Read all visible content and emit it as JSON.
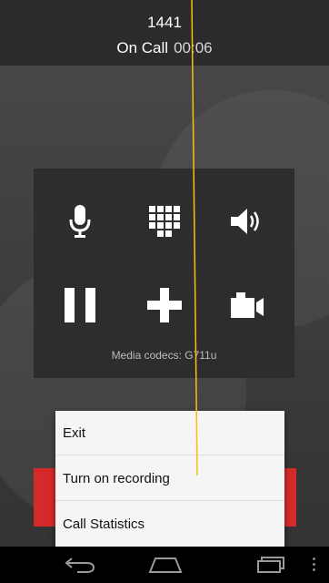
{
  "call": {
    "number": "1441",
    "status": "On Call",
    "timer": "00:06"
  },
  "controls": [
    {
      "name": "microphone-button",
      "icon": "microphone-icon"
    },
    {
      "name": "dialpad-button",
      "icon": "dialpad-icon"
    },
    {
      "name": "speaker-button",
      "icon": "speaker-icon"
    },
    {
      "name": "hold-button",
      "icon": "pause-icon"
    },
    {
      "name": "add-call-button",
      "icon": "plus-icon"
    },
    {
      "name": "video-button",
      "icon": "video-camera-icon"
    }
  ],
  "media": {
    "codecs_text": "Media codecs: G711u"
  },
  "menu": {
    "items": [
      {
        "label": "Exit"
      },
      {
        "label": "Turn on recording"
      },
      {
        "label": "Call Statistics"
      }
    ]
  },
  "navbar": {
    "buttons": [
      "back-icon",
      "home-icon",
      "recent-apps-icon",
      "overflow-menu-icon"
    ]
  },
  "colors": {
    "header_bg": "#2b2b2b",
    "panel_bg": "#2d2d2d",
    "hangup_red": "#d62a2a",
    "menu_bg": "#f5f5f5",
    "annotation_line": "#f2c500"
  }
}
